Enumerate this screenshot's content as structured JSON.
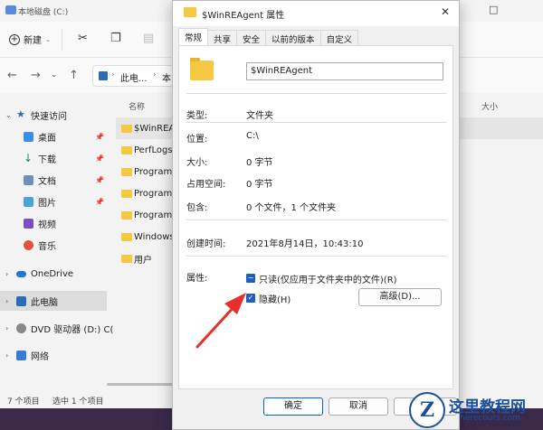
{
  "explorer": {
    "window_title": "本地磁盘 (C:)",
    "toolbar": {
      "new_label": "新建"
    },
    "address": {
      "crumb1": "此电...",
      "crumb2": "本"
    },
    "columns": {
      "name": "名称",
      "size": "大小"
    },
    "sidebar": [
      {
        "label": "快速访问",
        "icon": "star-icon",
        "pinned": false
      },
      {
        "label": "桌面",
        "icon": "desktop-icon",
        "pinned": true
      },
      {
        "label": "下载",
        "icon": "download-icon",
        "pinned": true
      },
      {
        "label": "文档",
        "icon": "document-icon",
        "pinned": true
      },
      {
        "label": "图片",
        "icon": "picture-icon",
        "pinned": true
      },
      {
        "label": "视频",
        "icon": "video-icon",
        "pinned": false
      },
      {
        "label": "音乐",
        "icon": "music-icon",
        "pinned": false
      },
      {
        "label": "OneDrive",
        "icon": "cloud-icon",
        "pinned": false
      },
      {
        "label": "此电脑",
        "icon": "pc-icon",
        "pinned": false
      },
      {
        "label": "DVD 驱动器 (D:) C(",
        "icon": "dvd-icon",
        "pinned": false
      },
      {
        "label": "网络",
        "icon": "network-icon",
        "pinned": false
      }
    ],
    "files": [
      "$WinREA",
      "PerfLogs",
      "Program",
      "Program",
      "Program",
      "Windows",
      "用户"
    ],
    "status": {
      "count": "7 个项目",
      "selected": "选中 1 个项目"
    }
  },
  "dialog": {
    "title": "$WinREAgent 属性",
    "tabs": [
      "常规",
      "共享",
      "安全",
      "以前的版本",
      "自定义"
    ],
    "name_value": "$WinREAgent",
    "rows": {
      "type_k": "类型:",
      "type_v": "文件夹",
      "loc_k": "位置:",
      "loc_v": "C:\\",
      "size_k": "大小:",
      "size_v": "0 字节",
      "disk_k": "占用空间:",
      "disk_v": "0 字节",
      "contains_k": "包含:",
      "contains_v": "0 个文件，1 个文件夹",
      "created_k": "创建时间:",
      "created_v": "2021年8月14日，10:43:10",
      "attr_k": "属性:"
    },
    "readonly_label": "只读(仅应用于文件夹中的文件)(R)",
    "hidden_label": "隐藏(H)",
    "advanced_label": "高级(D)...",
    "ok_label": "确定",
    "cancel_label": "取消"
  },
  "watermark": {
    "line1": "这里教程网",
    "line2": "herecours.com"
  },
  "colors": {
    "accent": "#1f5fbf",
    "arrow": "#e8302a",
    "folder": "#f5c842"
  }
}
